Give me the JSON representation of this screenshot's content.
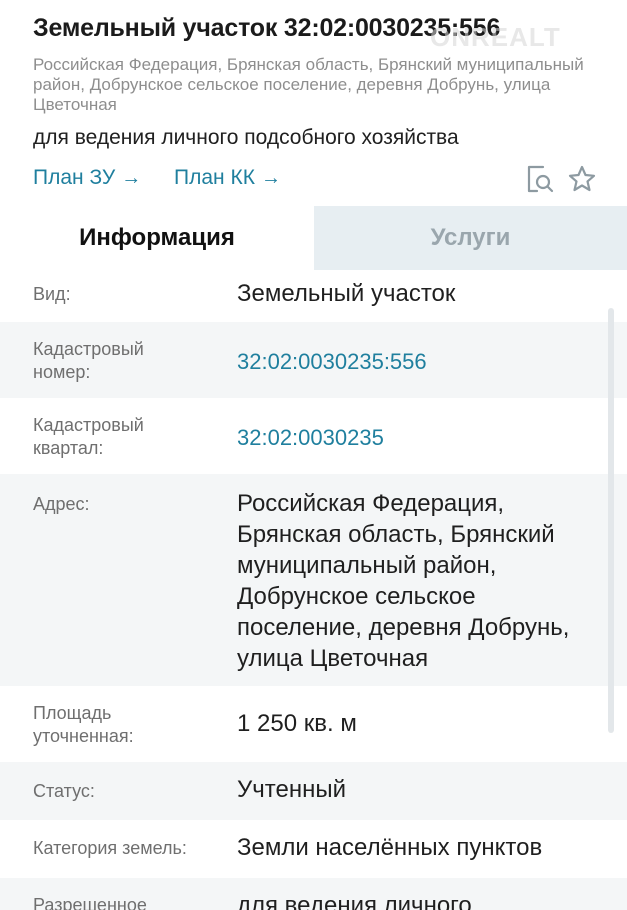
{
  "header": {
    "title": "Земельный участок 32:02:0030235:556",
    "watermark": "ONREALT",
    "address": "Российская Федерация, Брянская область, Брянский муниципальный район, Добрунское сельское поселение, деревня Добрунь, улица Цветочная",
    "purpose": "для ведения личного подсобного хозяйства",
    "links": {
      "plan_zu": "План ЗУ",
      "plan_kk": "План КК",
      "arrow": "→"
    },
    "icons": [
      "doc-search-icon",
      "star-icon"
    ]
  },
  "tabs": [
    {
      "label": "Информация",
      "active": true
    },
    {
      "label": "Услуги",
      "active": false
    }
  ],
  "rows": [
    {
      "label": "Вид:",
      "value": "Земельный участок"
    },
    {
      "label": "Кадастровый номер:",
      "value": "32:02:0030235:556"
    },
    {
      "label": "Кадастровый квартал:",
      "value": "32:02:0030235"
    },
    {
      "label": "Адрес:",
      "value": "Российская Федерация, Брянская область, Брянский муниципальный район, Добрунское сельское поселение, деревня Добрунь, улица Цветочная"
    },
    {
      "label": "Площадь уточненная:",
      "value": "1 250 кв. м"
    },
    {
      "label": "Статус:",
      "value": "Учтенный"
    },
    {
      "label": "Категория земель:",
      "value": "Земли населённых пунктов"
    },
    {
      "label": "Разрешенное",
      "value": "для ведения личного"
    }
  ],
  "colors": {
    "accent": "#1f7f9e",
    "row_alt": "#f4f6f7",
    "tab_inactive": "#e7eef2"
  }
}
